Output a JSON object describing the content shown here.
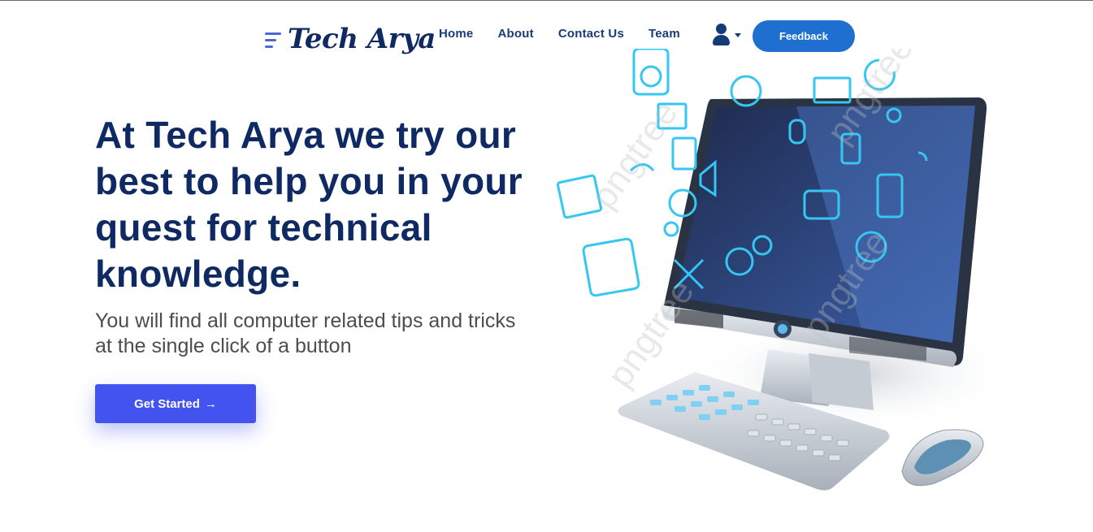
{
  "header": {
    "logo_text": "Tech Arya",
    "nav": [
      "Home",
      "About",
      "Contact Us",
      "Team"
    ],
    "feedback_label": "Feedback"
  },
  "hero": {
    "title": "At Tech Arya we try our best to help you in your quest for technical knowledge.",
    "subtitle": "You will find all computer related tips and tricks at the single click of a button",
    "cta_label": "Get Started",
    "cta_arrow": "→"
  },
  "illustration": {
    "watermark": "pngtree"
  },
  "colors": {
    "brand_navy": "#0f2a63",
    "feedback_blue": "#1f6fd1",
    "cta_blue": "#4353ef",
    "icon_cyan": "#35c6f2"
  }
}
